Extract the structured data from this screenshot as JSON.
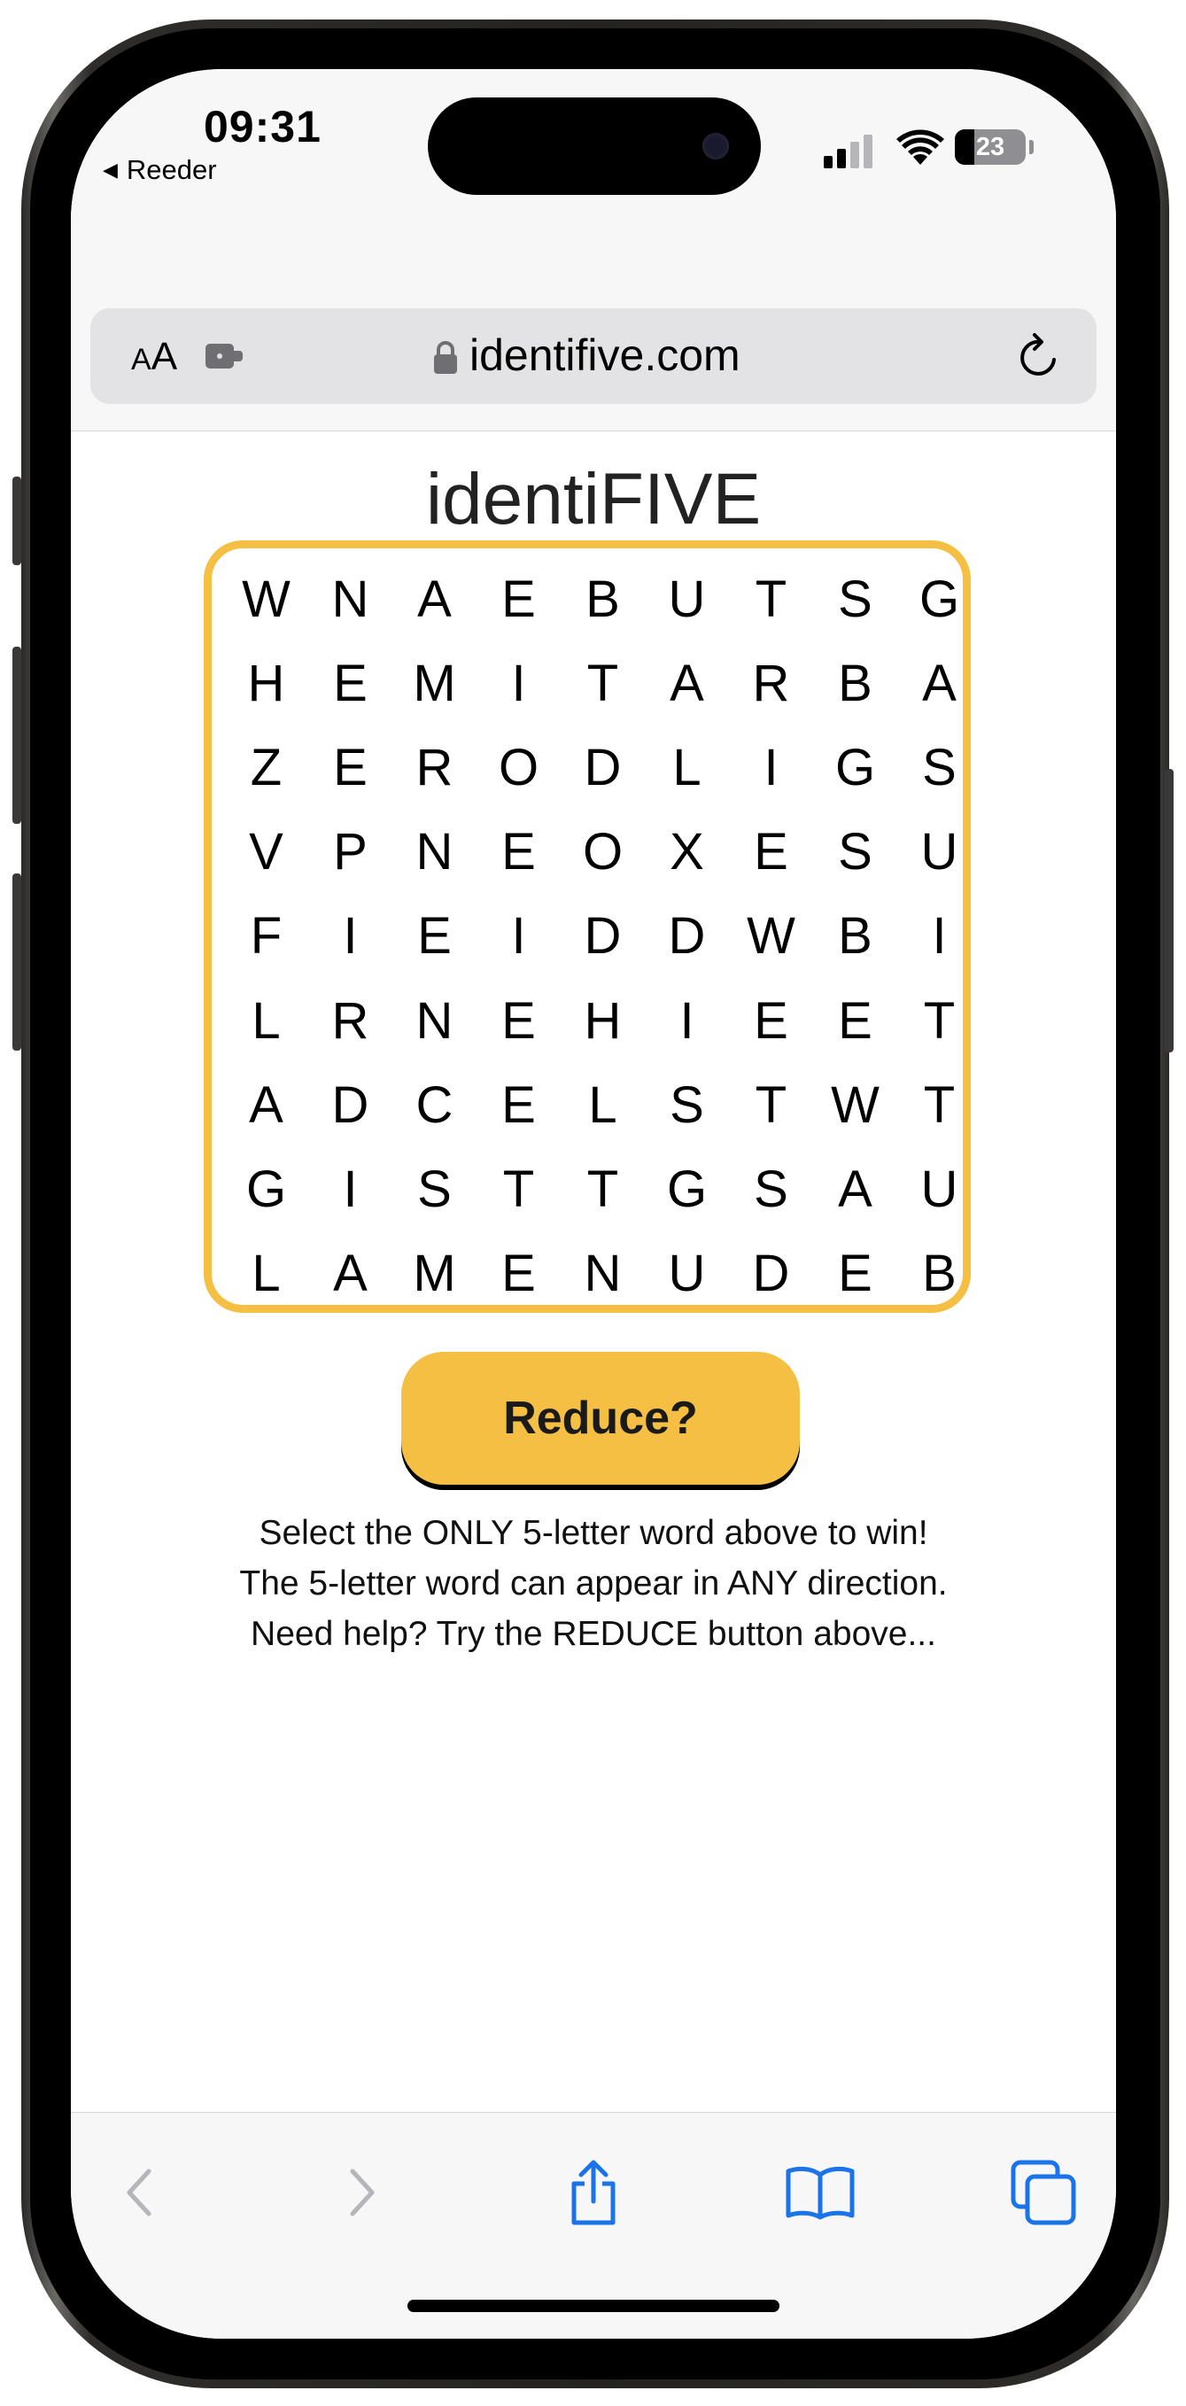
{
  "status_bar": {
    "time": "09:31",
    "back_app": "Reeder",
    "battery": "23"
  },
  "url_bar": {
    "text_size_small": "A",
    "text_size_big": "A",
    "domain": "identifive.com"
  },
  "page": {
    "title": "identiFIVE",
    "grid": [
      [
        "W",
        "N",
        "A",
        "E",
        "B",
        "U",
        "T",
        "S",
        "G"
      ],
      [
        "H",
        "E",
        "M",
        "I",
        "T",
        "A",
        "R",
        "B",
        "A"
      ],
      [
        "Z",
        "E",
        "R",
        "O",
        "D",
        "L",
        "I",
        "G",
        "S"
      ],
      [
        "V",
        "P",
        "N",
        "E",
        "O",
        "X",
        "E",
        "S",
        "U"
      ],
      [
        "F",
        "I",
        "E",
        "I",
        "D",
        "D",
        "W",
        "B",
        "I"
      ],
      [
        "L",
        "R",
        "N",
        "E",
        "H",
        "I",
        "E",
        "E",
        "T"
      ],
      [
        "A",
        "D",
        "C",
        "E",
        "L",
        "S",
        "T",
        "W",
        "T"
      ],
      [
        "G",
        "I",
        "S",
        "T",
        "T",
        "G",
        "S",
        "A",
        "U"
      ],
      [
        "L",
        "A",
        "M",
        "E",
        "N",
        "U",
        "D",
        "E",
        "B"
      ]
    ],
    "reduce_label": "Reduce?",
    "instructions": [
      "Select the ONLY 5-letter word above to win!",
      "The 5-letter word can appear in ANY direction.",
      "Need help? Try the REDUCE button above..."
    ],
    "accent_color": "#f4bf43"
  },
  "toolbar": {
    "icons": [
      "back-icon",
      "forward-icon",
      "share-icon",
      "bookmarks-icon",
      "tabs-icon"
    ],
    "active_color": "#1a73e8",
    "disabled_color": "#b5b5ba"
  }
}
